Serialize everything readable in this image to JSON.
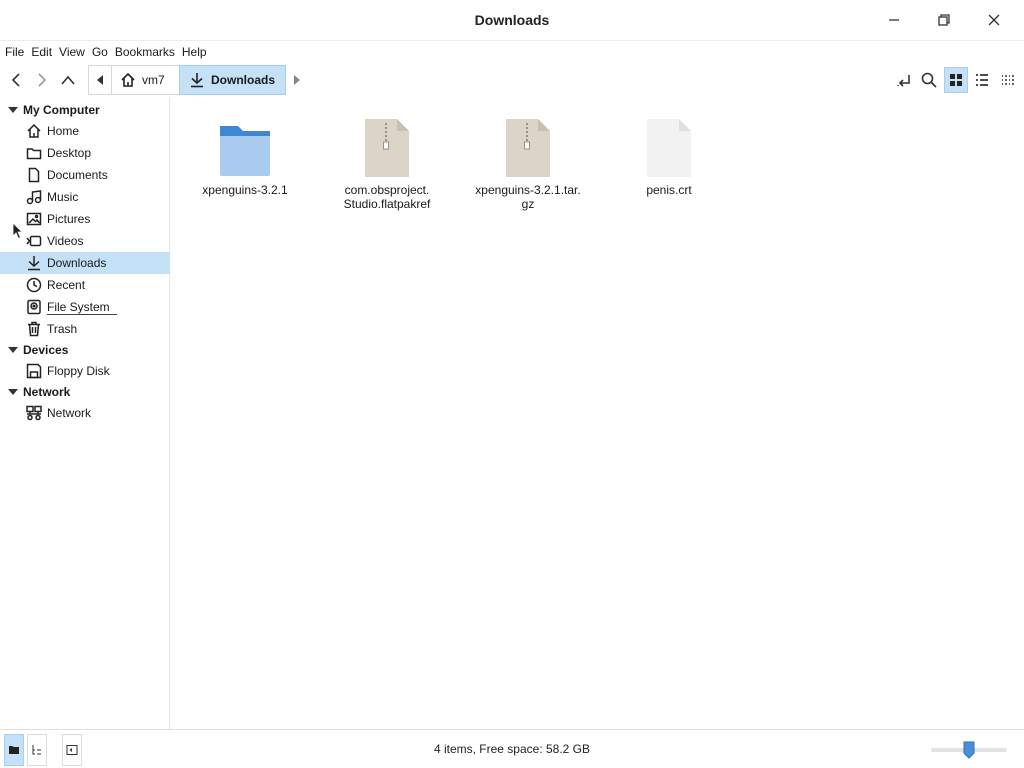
{
  "window": {
    "title": "Downloads"
  },
  "menu": [
    "File",
    "Edit",
    "View",
    "Go",
    "Bookmarks",
    "Help"
  ],
  "breadcrumb": {
    "home_label": "vm7",
    "current_label": "Downloads"
  },
  "sidebar": {
    "sections": [
      {
        "title": "My Computer",
        "items": [
          {
            "label": "Home",
            "icon": "home-icon"
          },
          {
            "label": "Desktop",
            "icon": "folder-icon"
          },
          {
            "label": "Documents",
            "icon": "document-icon"
          },
          {
            "label": "Music",
            "icon": "music-icon"
          },
          {
            "label": "Pictures",
            "icon": "picture-icon"
          },
          {
            "label": "Videos",
            "icon": "video-icon"
          },
          {
            "label": "Downloads",
            "icon": "download-icon",
            "selected": true
          },
          {
            "label": "Recent",
            "icon": "clock-icon"
          },
          {
            "label": "File System",
            "icon": "drive-icon"
          },
          {
            "label": "Trash",
            "icon": "trash-icon"
          }
        ]
      },
      {
        "title": "Devices",
        "items": [
          {
            "label": "Floppy Disk",
            "icon": "floppy-icon"
          }
        ]
      },
      {
        "title": "Network",
        "items": [
          {
            "label": "Network",
            "icon": "network-icon"
          }
        ]
      }
    ]
  },
  "files": [
    {
      "name_lines": [
        "xpenguins-3.2.1"
      ],
      "type": "folder"
    },
    {
      "name_lines": [
        "com.obsproject.",
        "Studio.flatpakref"
      ],
      "type": "archive"
    },
    {
      "name_lines": [
        "xpenguins-3.2.1.tar.",
        "gz"
      ],
      "type": "archive"
    },
    {
      "name_lines": [
        "penis.crt"
      ],
      "type": "blank"
    }
  ],
  "status": {
    "text": "4 items, Free space: 58.2 GB"
  },
  "colors": {
    "accent": "#c5e1f7",
    "folder": "#5a9be0",
    "archive": "#ddd4c8"
  }
}
